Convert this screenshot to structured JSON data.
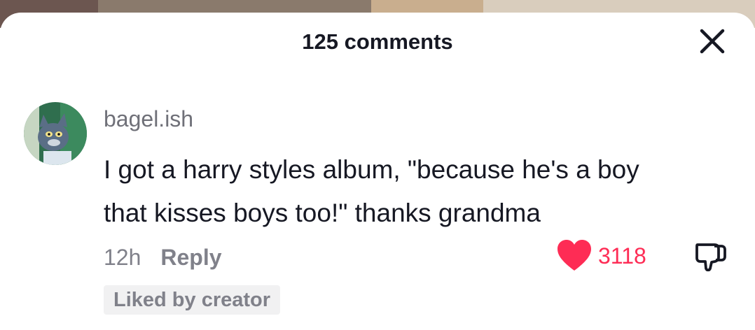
{
  "header": {
    "title": "125 comments"
  },
  "comment": {
    "username": "bagel.ish",
    "text_lines": [
      "I got a harry styles album, \"because he's a boy",
      "that kisses boys too!\" thanks grandma"
    ],
    "time": "12h",
    "reply_label": "Reply",
    "like_count": "3118",
    "liked_badge": "Liked by creator"
  },
  "icons": {
    "close": "close-icon",
    "like": "heart-icon",
    "dislike": "thumbs-down-icon"
  },
  "colors": {
    "accent": "#fe2c55",
    "text": "#161823",
    "muted": "#80818a",
    "badge_bg": "#f1f1f2"
  }
}
